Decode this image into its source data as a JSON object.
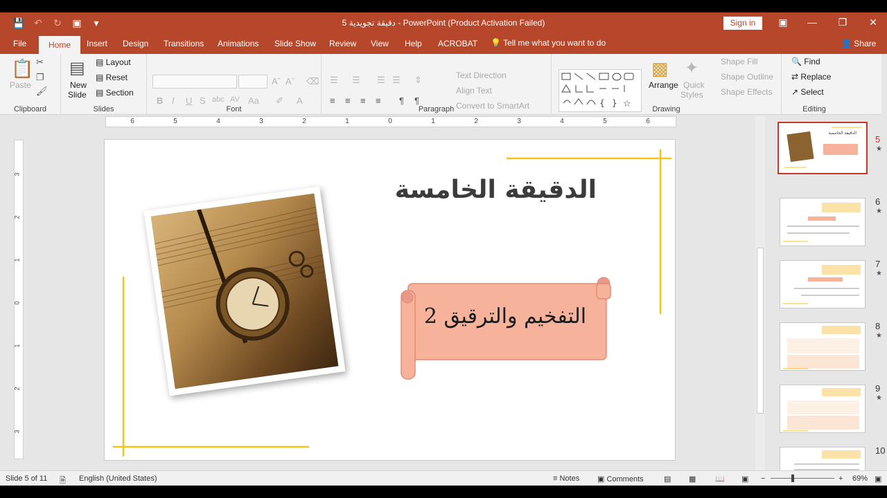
{
  "titlebar": {
    "title": "دقيقة تجويدية 5  -  PowerPoint (Product Activation Failed)",
    "sign_in": "Sign in"
  },
  "tabs": [
    "File",
    "Home",
    "Insert",
    "Design",
    "Transitions",
    "Animations",
    "Slide Show",
    "Review",
    "View",
    "Help",
    "ACROBAT"
  ],
  "active_tab": "Home",
  "tell_me": "Tell me what you want to do",
  "share": "Share",
  "ribbon": {
    "clipboard": {
      "label": "Clipboard",
      "paste": "Paste"
    },
    "slides": {
      "label": "Slides",
      "new_slide_1": "New",
      "new_slide_2": "Slide",
      "layout": "Layout",
      "reset": "Reset",
      "section": "Section"
    },
    "font": {
      "label": "Font"
    },
    "paragraph": {
      "label": "Paragraph",
      "text_direction": "Text Direction",
      "align_text": "Align Text",
      "convert": "Convert to SmartArt"
    },
    "drawing": {
      "label": "Drawing",
      "arrange": "Arrange",
      "quick_styles_1": "Quick",
      "quick_styles_2": "Styles",
      "shape_fill": "Shape Fill",
      "shape_outline": "Shape Outline",
      "shape_effects": "Shape Effects"
    },
    "editing": {
      "label": "Editing",
      "find": "Find",
      "replace": "Replace",
      "select": "Select"
    }
  },
  "ruler_numbers": [
    "6",
    "5",
    "4",
    "3",
    "2",
    "1",
    "0",
    "1",
    "2",
    "3",
    "4",
    "5",
    "6"
  ],
  "vruler_numbers": [
    "3",
    "2",
    "1",
    "0",
    "1",
    "2",
    "3"
  ],
  "slide": {
    "title": "الدقيقة الخامسة",
    "scroll_text": "التفخيم والترقيق 2",
    "colors": {
      "gold": "#f0c419",
      "scroll": "#f6b29a",
      "scroll_edge": "#e38b73"
    }
  },
  "thumbnails": [
    {
      "num": "5",
      "selected": true
    },
    {
      "num": "6",
      "selected": false
    },
    {
      "num": "7",
      "selected": false
    },
    {
      "num": "8",
      "selected": false
    },
    {
      "num": "9",
      "selected": false
    },
    {
      "num": "10",
      "selected": false
    }
  ],
  "status": {
    "slide_info": "Slide 5 of 11",
    "language": "English (United States)",
    "notes": "Notes",
    "comments": "Comments",
    "zoom": "69%"
  }
}
